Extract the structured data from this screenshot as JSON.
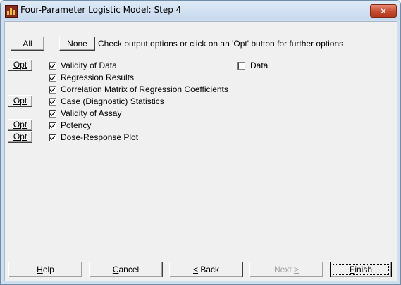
{
  "window": {
    "title": "Four-Parameter Logistic Model: Step 4",
    "close_glyph": "✕"
  },
  "header": {
    "all_label": "All",
    "none_label": "None",
    "hint": "Check output options or click on an 'Opt' button for further options"
  },
  "opt_label": "Opt",
  "options": [
    {
      "label": "Validity of Data",
      "checked": true,
      "has_opt": true
    },
    {
      "label": "Regression Results",
      "checked": true,
      "has_opt": false
    },
    {
      "label": "Correlation Matrix of Regression Coefficients",
      "checked": true,
      "has_opt": false
    },
    {
      "label": "Case (Diagnostic) Statistics",
      "checked": true,
      "has_opt": true
    },
    {
      "label": "Validity of Assay",
      "checked": true,
      "has_opt": false
    },
    {
      "label": "Potency",
      "checked": true,
      "has_opt": true
    },
    {
      "label": "Dose-Response Plot",
      "checked": true,
      "has_opt": true
    }
  ],
  "data_option": {
    "label": "Data",
    "checked": false
  },
  "footer": {
    "help": {
      "pre": "",
      "key": "H",
      "post": "elp"
    },
    "cancel": {
      "pre": "",
      "key": "C",
      "post": "ancel"
    },
    "back": {
      "pre": "",
      "key": "<",
      "post": " Back"
    },
    "next": {
      "pre": "Next ",
      "key": ">",
      "post": ""
    },
    "finish": {
      "pre": "",
      "key": "F",
      "post": "inish"
    }
  }
}
